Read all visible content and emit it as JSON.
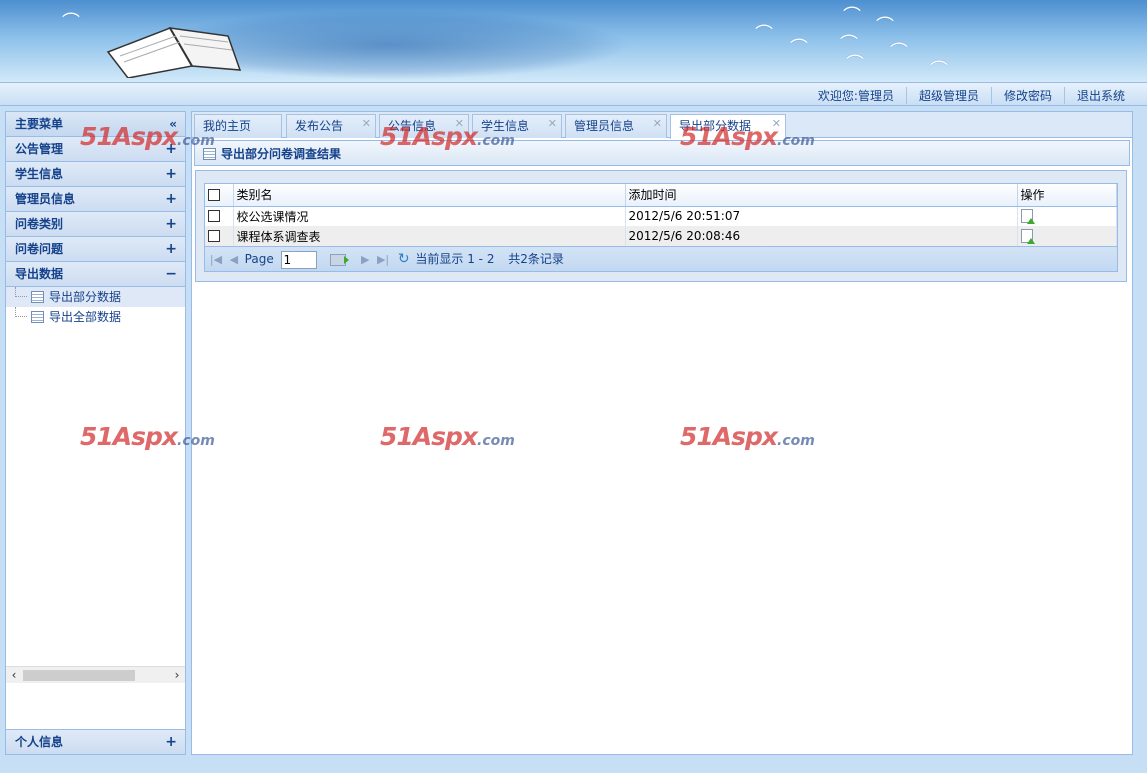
{
  "header": {
    "links": [
      "欢迎您:管理员",
      "超级管理员",
      "修改密码",
      "退出系统"
    ]
  },
  "sidebar": {
    "title": "主要菜单",
    "collapse_icon": "double-chevron-left-icon",
    "groups": [
      {
        "label": "公告管理",
        "toggle": "+"
      },
      {
        "label": "学生信息",
        "toggle": "+"
      },
      {
        "label": "管理员信息",
        "toggle": "+"
      },
      {
        "label": "问卷类别",
        "toggle": "+"
      },
      {
        "label": "问卷问题",
        "toggle": "+"
      },
      {
        "label": "导出数据",
        "toggle": "−"
      }
    ],
    "tree": [
      {
        "label": "导出部分数据",
        "selected": true
      },
      {
        "label": "导出全部数据",
        "selected": false
      }
    ],
    "bottom_group": {
      "label": "个人信息",
      "toggle": "+"
    }
  },
  "tabs": [
    {
      "label": "我的主页",
      "closable": false
    },
    {
      "label": "发布公告",
      "closable": true
    },
    {
      "label": "公告信息",
      "closable": true
    },
    {
      "label": "学生信息",
      "closable": true
    },
    {
      "label": "管理员信息",
      "closable": true
    },
    {
      "label": "导出部分数据",
      "closable": true,
      "active": true
    }
  ],
  "panel": {
    "title": "导出部分问卷调查结果"
  },
  "grid": {
    "columns": [
      "类别名",
      "添加时间",
      "操作"
    ],
    "rows": [
      {
        "name": "校公选课情况",
        "time": "2012/5/6 20:51:07"
      },
      {
        "name": "课程体系调查表",
        "time": "2012/5/6 20:08:46"
      }
    ]
  },
  "pager": {
    "page_label": "Page",
    "page_value": "1",
    "display_info": "当前显示 1 - 2",
    "total_info": "共2条记录"
  },
  "watermark": {
    "brand": "51Aspx",
    "domain": ".com"
  },
  "colors": {
    "accent": "#15428b",
    "border": "#99bbe8",
    "background": "#c7dff5"
  }
}
